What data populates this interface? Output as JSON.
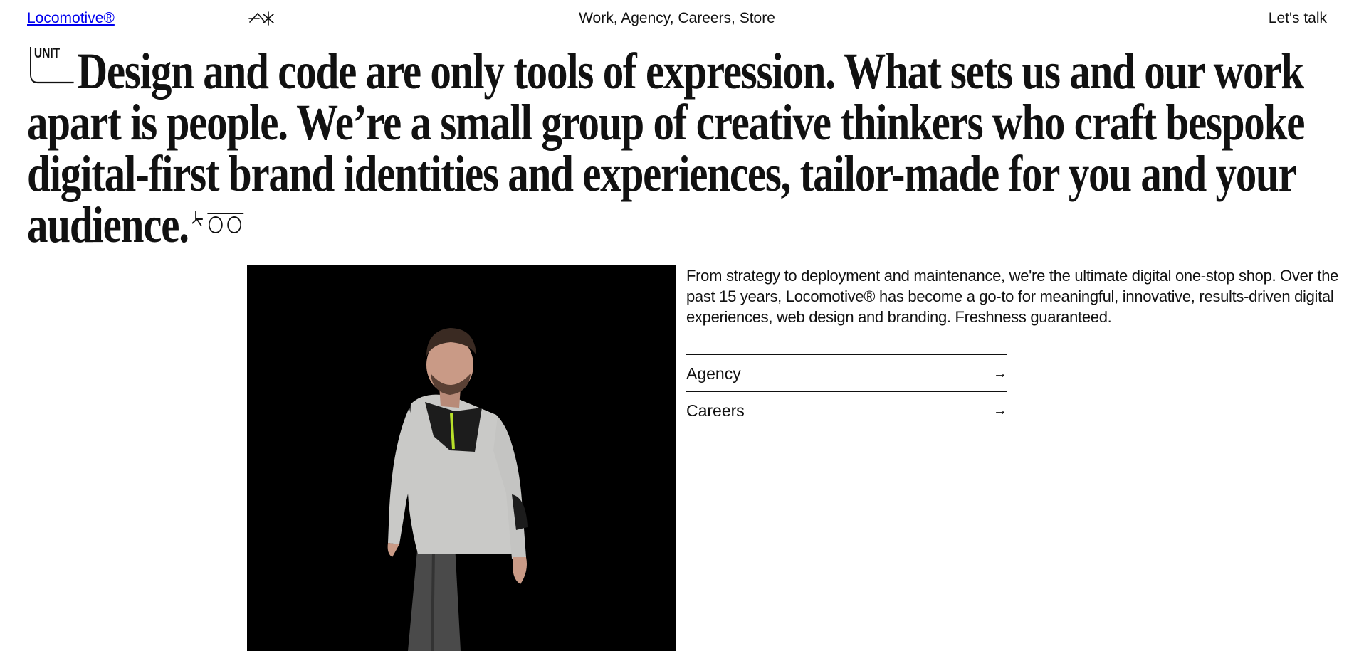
{
  "header": {
    "logo": "Locomotive®",
    "logo_mark_icon": "locomotive-glyph-icon",
    "nav_text": "Work, Agency, Careers, Store",
    "cta": "Let's talk"
  },
  "headline": {
    "badge": "UNIT",
    "text": "Design and code are only tools of expression. What sets us and our work apart is people. We’re a small group of creative thinkers who craft bespoke digital-first brand identities and experiences, tailor-made for you and your audience."
  },
  "media": {
    "background": "#000000",
    "subject": "person-walking-image"
  },
  "intro": {
    "text": "From strategy to deployment and maintenance, we're the ultimate digital one-stop shop. Over the past 15 years, Locomotive® has become a go-to for meaningful, innovative, results-driven digital experiences, web design and branding. Freshness guaranteed."
  },
  "links": [
    {
      "label": "Agency",
      "icon": "arrow-right-icon"
    },
    {
      "label": "Careers",
      "icon": "arrow-right-icon"
    }
  ]
}
